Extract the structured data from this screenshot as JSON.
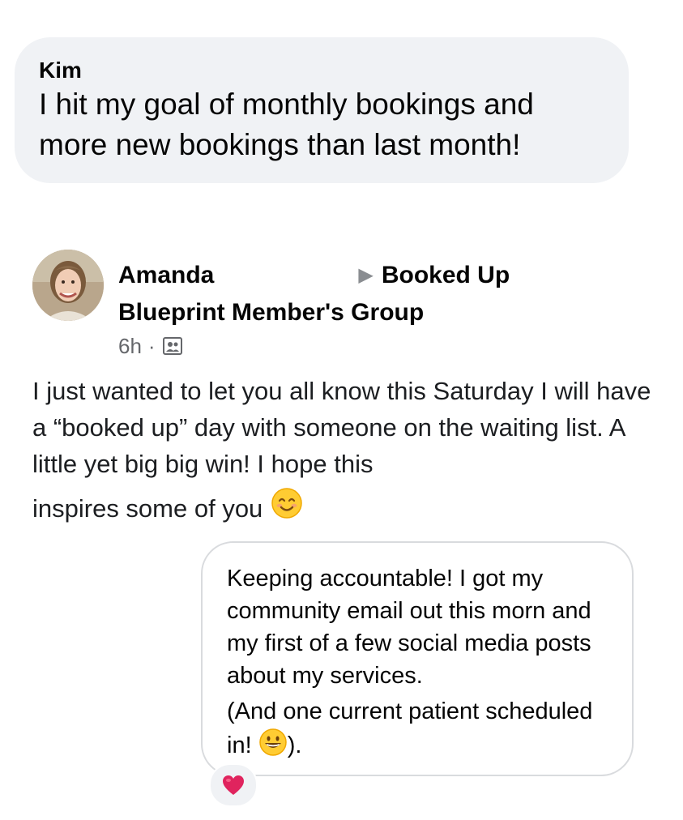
{
  "comment": {
    "author": "Kim",
    "text": "I hit my goal of monthly bookings and more new bookings than last month!"
  },
  "post": {
    "author": "Amanda",
    "group_line1": "Booked Up",
    "group_line2": "Blueprint Member's Group",
    "time": "6h",
    "separator": "·",
    "audience_icon": "group-icon",
    "body": "I just wanted to let you all know this Saturday I will have a “booked up” day with someone on the waiting list. A little yet big big win! I hope this",
    "body_last": "inspires some of you",
    "body_emoji": "smiling-face-emoji"
  },
  "reply": {
    "para1": "Keeping accountable! I got my community email out this morn and my first of a few social media posts about my services.",
    "para2_start": "(And one current patient scheduled in!",
    "para2_emoji": "grinning-face-emoji",
    "para2_end": ").",
    "reaction": "heart-reaction"
  },
  "colors": {
    "bubble_bg": "#f0f2f5",
    "secondary_text": "#65676b",
    "heart": "#e0245e"
  }
}
